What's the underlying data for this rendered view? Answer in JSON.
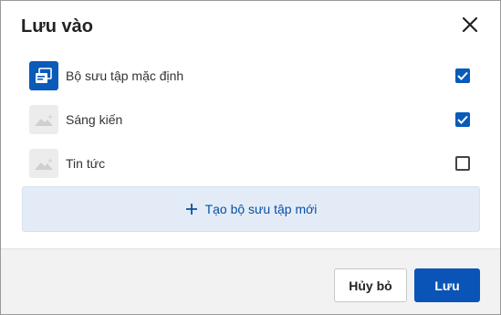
{
  "dialog": {
    "title": "Lưu vào",
    "close_icon": "close-icon"
  },
  "collections": [
    {
      "label": "Bộ sưu tập mặc định",
      "checked": true,
      "thumbnail": "default-collection-icon"
    },
    {
      "label": "Sáng kiến",
      "checked": true,
      "thumbnail": "image-placeholder-icon"
    },
    {
      "label": "Tin tức",
      "checked": false,
      "thumbnail": "image-placeholder-icon"
    }
  ],
  "create_new": {
    "label": "Tạo bộ sưu tập mới",
    "icon": "plus-icon"
  },
  "footer": {
    "cancel_label": "Hủy bỏ",
    "save_label": "Lưu"
  },
  "colors": {
    "accent": "#0a5ab9",
    "create_bg": "#e3ecf6",
    "footer_bg": "#f2f2f2"
  }
}
